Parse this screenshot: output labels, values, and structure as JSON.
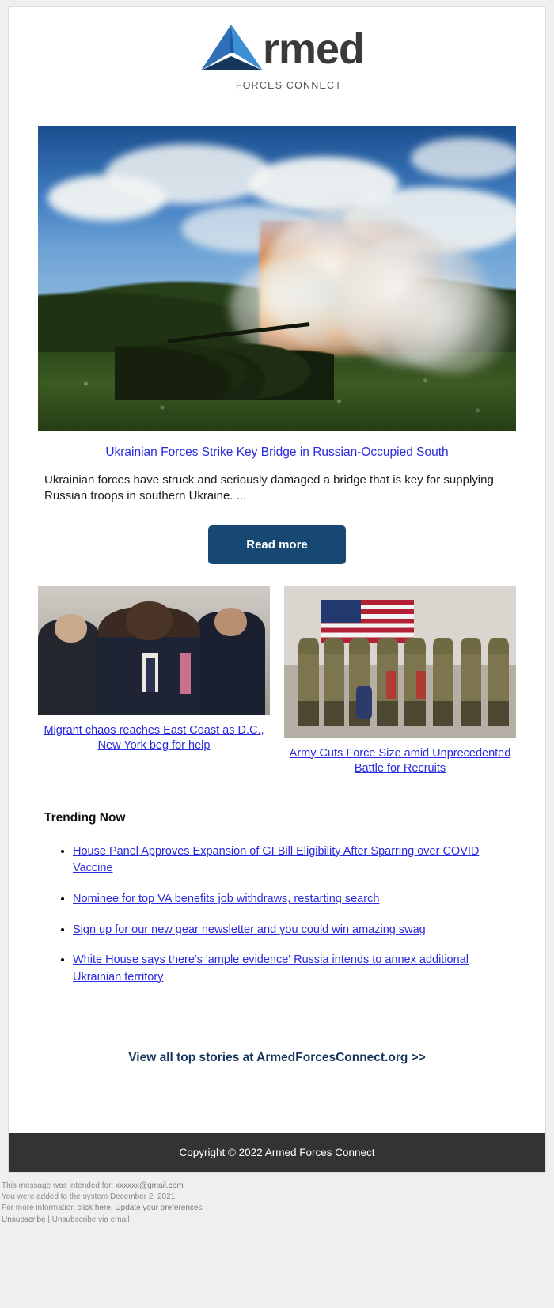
{
  "brand": {
    "logo_word": "rmed",
    "logo_tagline": "FORCES CONNECT",
    "logo_colors": {
      "light_blue": "#3b8fd4",
      "mid_blue": "#2f6fb5",
      "dark_navy": "#16365c",
      "word_gray": "#3a3a3a"
    }
  },
  "hero": {
    "image_alt": "artillery crew firing howitzer with muzzle flash and smoke in a field",
    "headline": "Ukrainian Forces Strike Key Bridge in Russian-Occupied South",
    "summary": "Ukrainian forces have struck and seriously damaged a bridge that is key for supplying Russian troops in southern Ukraine. ...",
    "cta_label": "Read more",
    "cta_color": "#174873"
  },
  "stories": [
    {
      "image_alt": "officials seated at a press conference, man in dark suit speaking",
      "caption_line1": "Migrant chaos reaches East Coast as",
      "caption_line2": "D.C., New York beg for help"
    },
    {
      "image_alt": "soldiers in camouflage uniforms walking through a hall with a large American flag",
      "caption_line1": "Army Cuts Force Size amid",
      "caption_line2": "Unprecedented Battle for Recruits"
    }
  ],
  "trending": {
    "title": "Trending Now",
    "items": [
      "House Panel Approves Expansion of GI Bill Eligibility After Sparring over COVID Vaccine",
      "Nominee for top VA benefits job withdraws, restarting search",
      "Sign up for our new gear newsletter and you could win amazing swag",
      "White House says there's 'ample evidence' Russia intends to annex additional Ukrainian territory"
    ]
  },
  "view_all": {
    "label": "View all top stories at ArmedForcesConnect.org >>",
    "color": "#16365c"
  },
  "footer": {
    "copyright": "Copyright © 2022 Armed Forces Connect",
    "bar_color": "#333333"
  },
  "fine_print": {
    "intended_prefix": "This message was intended for: ",
    "intended_email": "xxxxxx@gmail.com",
    "added_line": "You were added to the system December 2, 2021.",
    "more_info_prefix": "For more information ",
    "click_here": "click here",
    "more_info_separator": ". ",
    "update_prefs": "Update your preferences",
    "unsubscribe": "Unsubscribe",
    "unsubscribe_separator": " | ",
    "unsubscribe_via_email": "Unsubscribe via email"
  },
  "link_color": "#2a2ae0"
}
